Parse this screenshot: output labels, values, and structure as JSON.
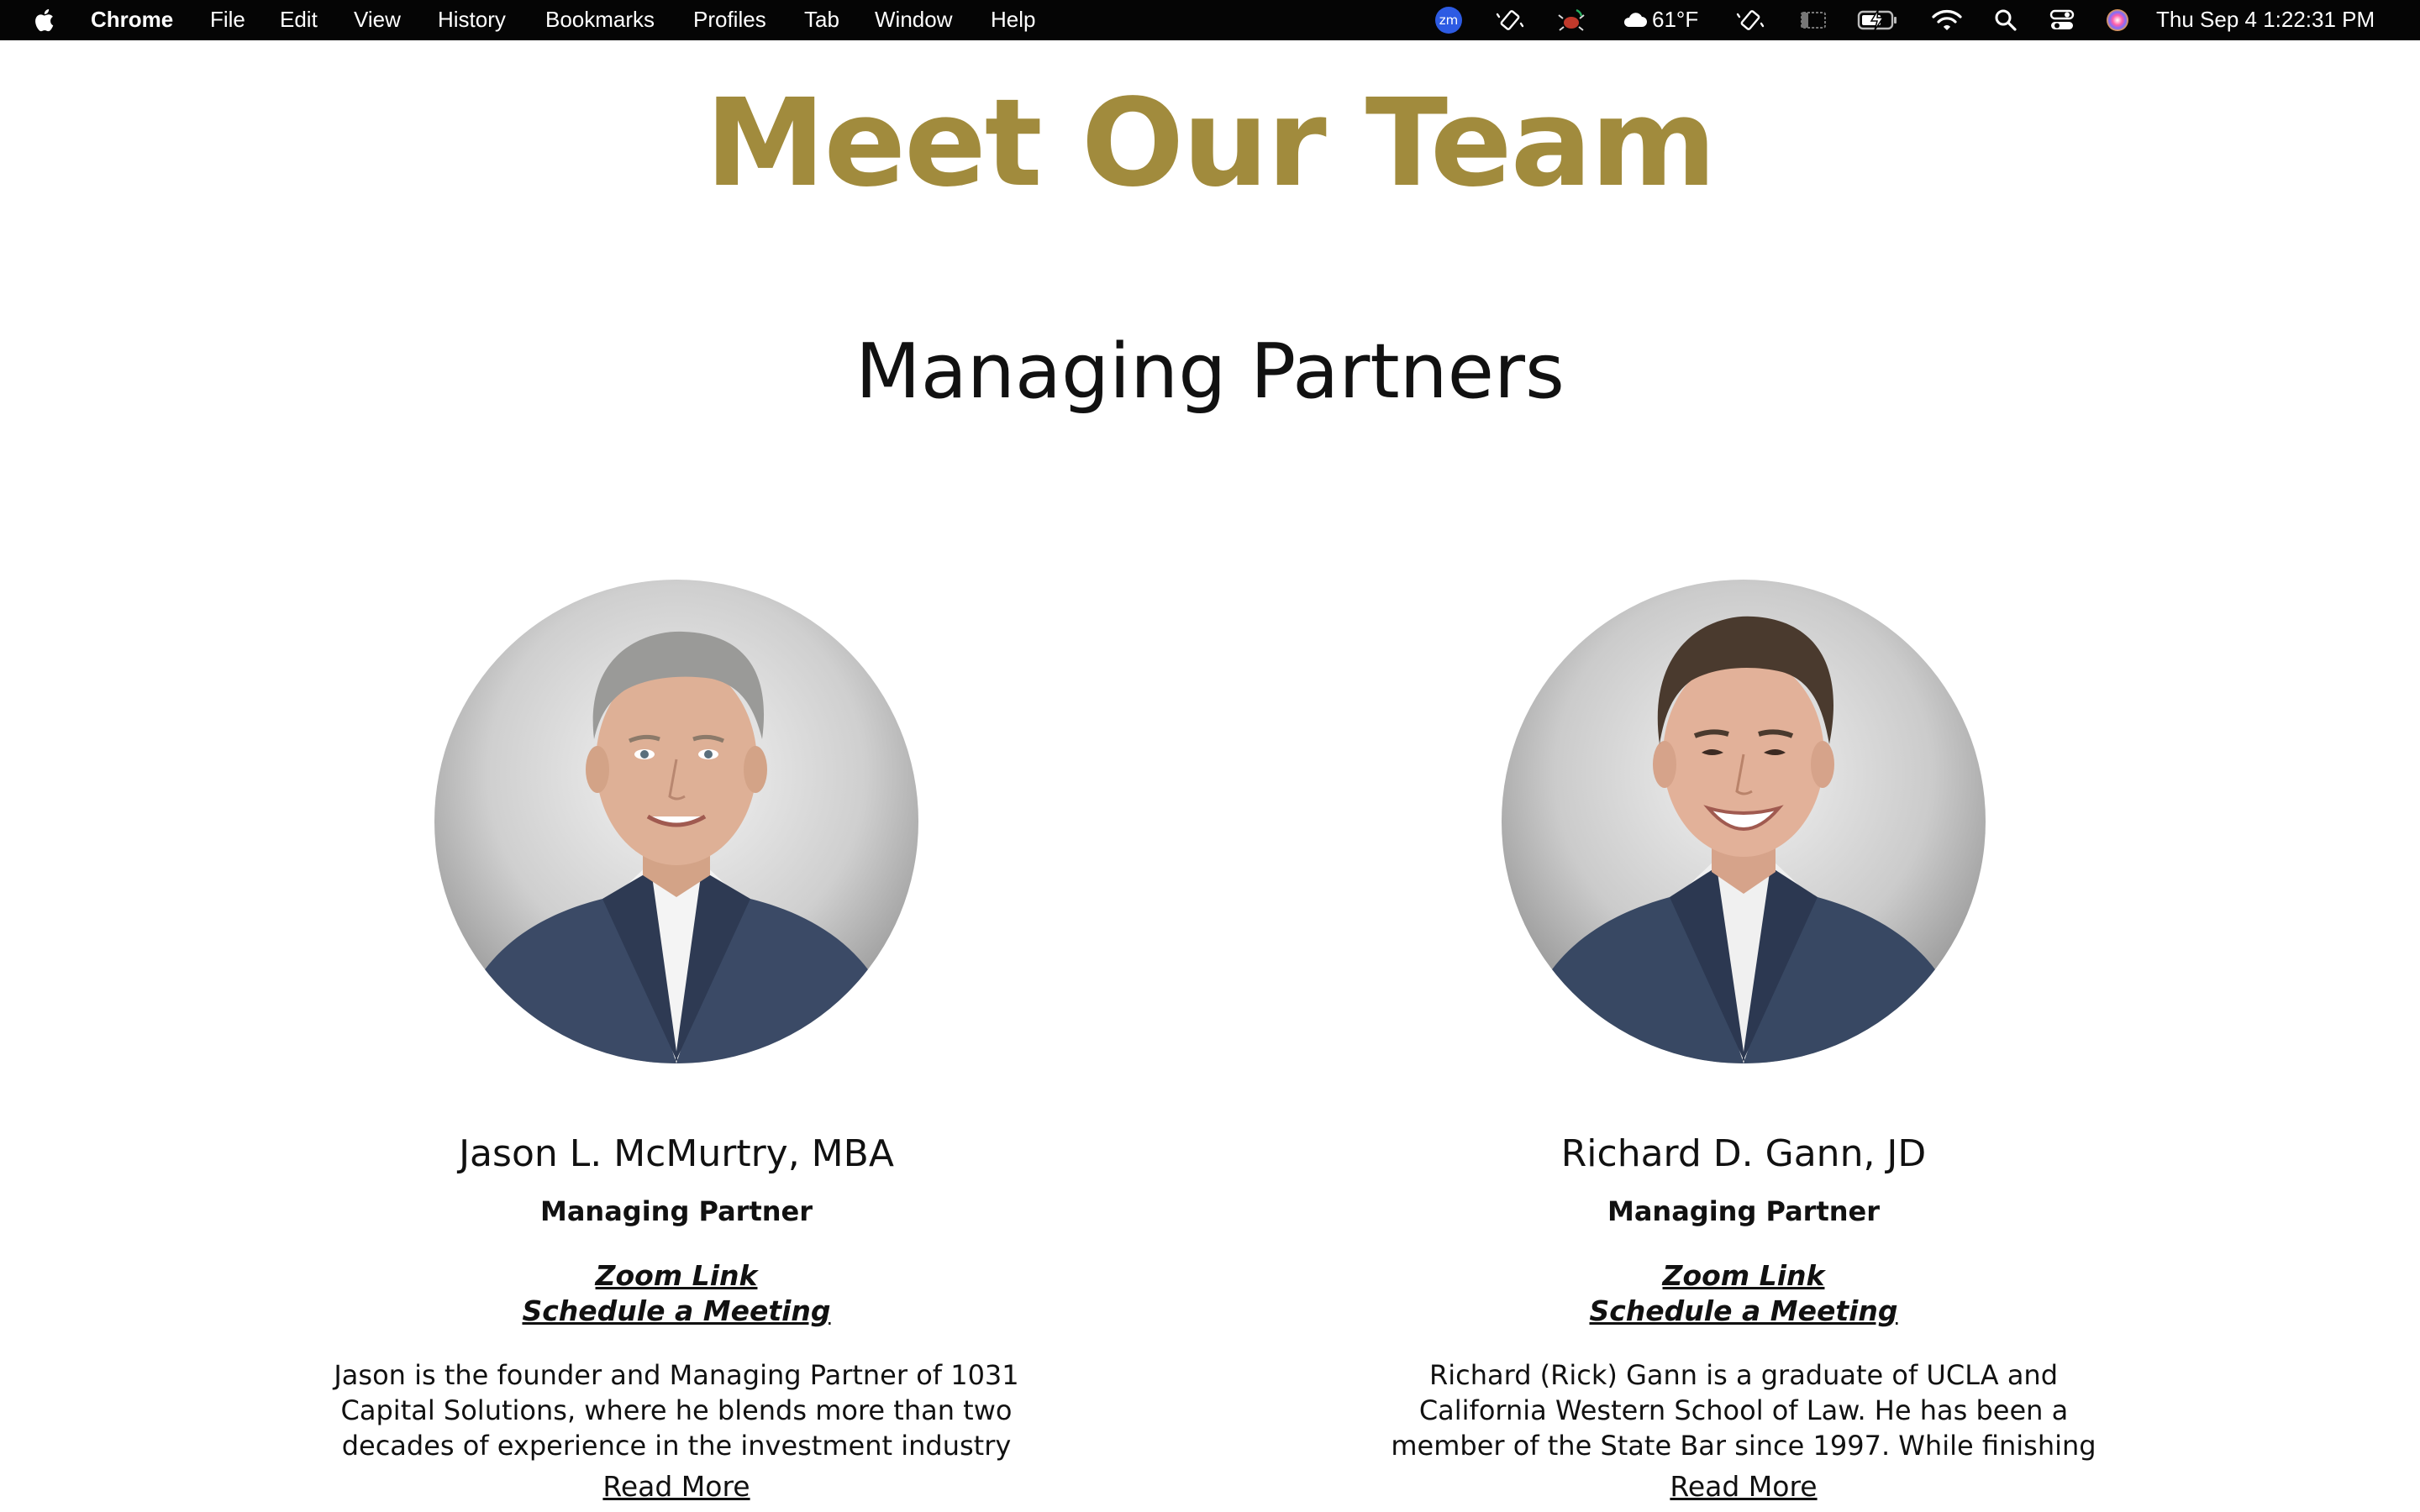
{
  "menubar": {
    "app_name": "Chrome",
    "menus": [
      "File",
      "Edit",
      "View",
      "History",
      "Bookmarks",
      "Profiles",
      "Tab",
      "Window",
      "Help"
    ],
    "weather": "61°F",
    "datetime": "Thu Sep 4  1:22:31 PM",
    "zoom_badge": "zm"
  },
  "page": {
    "title": "Meet Our Team",
    "section_title": "Managing Partners",
    "accent_color": "#A18B3D",
    "partners": [
      {
        "name": "Jason L. McMurtry, MBA",
        "role": "Managing Partner",
        "zoom_link": "Zoom Link",
        "schedule_link": "Schedule a Meeting",
        "bio": "Jason is the founder and Managing Partner of 1031 Capital Solutions, where he blends more than two decades of experience in the investment industry",
        "read_more": "Read More"
      },
      {
        "name": "Richard D. Gann, JD",
        "role": "Managing Partner",
        "zoom_link": "Zoom Link",
        "schedule_link": "Schedule a Meeting",
        "bio": "Richard (Rick) Gann is a graduate of UCLA and California Western School of Law. He has been a member of the State Bar since 1997. While finishing",
        "read_more": "Read More"
      }
    ]
  }
}
